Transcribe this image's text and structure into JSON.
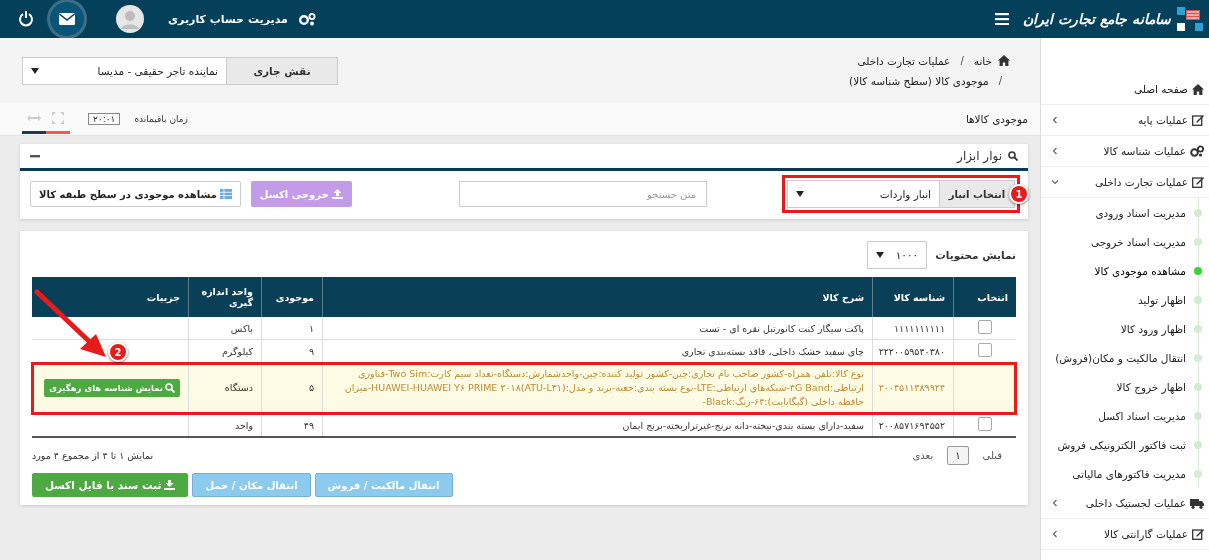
{
  "top_bar": {
    "title": "سامانه جامع تجارت ایران",
    "account_label": "مدیریت حساب کاربری"
  },
  "header": {
    "breadcrumb": [
      "خانه",
      "عملیات تجارت داخلی",
      "موجودی کالا (سطح شناسه کالا)"
    ],
    "breadcrumb_separators": [
      "/",
      "/"
    ],
    "role_label": "نقش جاری",
    "role_value": "نماینده تاجر حقیقی - مدیسا"
  },
  "tab_strip": {
    "title": "موجودی کالاها",
    "timer_label": "زمان باقیمانده",
    "timer": "۲۰:۰۱"
  },
  "toolbar": {
    "title": "نوار ابزار",
    "warehouse_label": "انتخاب انبار",
    "warehouse_value": "انبار واردات",
    "search_placeholder": "متن جستجو",
    "buttons": [
      {
        "label": "خروجی اکسل",
        "kind": "excel"
      },
      {
        "label": "مشاهده موجودی در سطح طبقه کالا",
        "kind": "class-view"
      }
    ]
  },
  "table": {
    "page_size_label": "نمایش محتویات",
    "page_size": "۱۰۰۰",
    "columns": [
      "انتخاب",
      "شناسه کالا",
      "شرح کالا",
      "موجودی",
      "واحد اندازه گیری",
      "جزییات"
    ],
    "rows": [
      {
        "kind": "checkbox",
        "checked": false,
        "id": "۱۱۱۱۱۱۱۱۱۱",
        "description": "پاکت سیگار کنت کانورتبل نقره ای - تست",
        "quantity": "۱",
        "unit": "باکس"
      },
      {
        "kind": "checkbox",
        "checked": false,
        "id": "۲۲۲۰۰۵۹۵۴۰۳۸۰",
        "description": "چای سفید خشک داخلی، فاقد بسته‌بندی تجاری",
        "quantity": "۹",
        "unit": "کیلوگرم"
      },
      {
        "kind": "tracked",
        "highlighted": true,
        "id": "۲۰۰۴۵۱۱۳۸۹۹۲۴",
        "description": "نوع کالا:تلفن همراه-کشور صاحب نام تجاری:چین-کشور تولید کننده:چین-واحدشمارش:دستگاه-تعداد سیم کارت:Two Sim-فناوری ارتباطی:۴G Band-شبکه‌های ارتباطی:LTE-نوع بسته بندی:جعبه-برند و مدل:HUAWEI-HUAWEI Y۶ PRIME ۲۰۱۸(ATU-L۳۱)-میزان حافظه داخلی (گیگابایت):۶۴-رنگ:Black-",
        "quantity": "۵",
        "unit": "دستگاه",
        "details": "نمایش شناسه های رهگیری"
      },
      {
        "kind": "checkbox",
        "checked": false,
        "id": "۲۰۰۸۵۷۱۶۹۴۵۵۲",
        "description": "سفید-دارای بسته بندی-نیخته-دانه برنج-غیرتراریخته-برنج ایمان",
        "quantity": "۴۹",
        "unit": "واحد"
      }
    ],
    "pagination": {
      "previous": "قبلی",
      "pages": [
        "۱"
      ],
      "next": "بعدی"
    },
    "summary": "نمایش ۱ تا ۴ از مجموع ۴ مورد",
    "actions": [
      {
        "label": "انتقال مالکیت / فروش",
        "kind": "transfer"
      },
      {
        "label": "انتقال مکان / حمل",
        "kind": "transfer"
      },
      {
        "label": "ثبت سند با فایل اکسل",
        "kind": "import"
      }
    ]
  },
  "annotations": [
    {
      "label": "1",
      "kind": "warehouse"
    },
    {
      "label": "2",
      "kind": "row"
    }
  ],
  "sidebar": {
    "items": [
      {
        "label": "صفحه اصلی",
        "kind": "link"
      },
      {
        "label": "عملیات پایه",
        "kind": "group",
        "expanded": false
      },
      {
        "label": "عملیات شناسه کالا",
        "kind": "group",
        "expanded": false
      },
      {
        "label": "عملیات تجارت داخلی",
        "kind": "group",
        "expanded": true,
        "children": [
          {
            "label": "مدیریت اسناد ورودی",
            "selected": false
          },
          {
            "label": "مدیریت اسناد خروجی",
            "selected": false
          },
          {
            "label": "مشاهده موجودی کالا",
            "selected": true
          },
          {
            "label": "اظهار تولید",
            "selected": false
          },
          {
            "label": "اظهار ورود کالا",
            "selected": false
          },
          {
            "label": "انتقال مالکیت و مکان(فروش)",
            "selected": false
          },
          {
            "label": "اظهار خروج کالا",
            "selected": false
          },
          {
            "label": "مدیریت اسناد اکسل",
            "selected": false
          },
          {
            "label": "ثبت فاکتور الکترونیکی فروش",
            "selected": false
          },
          {
            "label": "مدیریت فاکتورهای مالیاتی",
            "selected": false
          }
        ]
      },
      {
        "label": "عملیات لجستیک داخلی",
        "kind": "group",
        "expanded": false
      },
      {
        "label": "عملیات گارانتی کالا",
        "kind": "group",
        "expanded": false
      }
    ]
  }
}
